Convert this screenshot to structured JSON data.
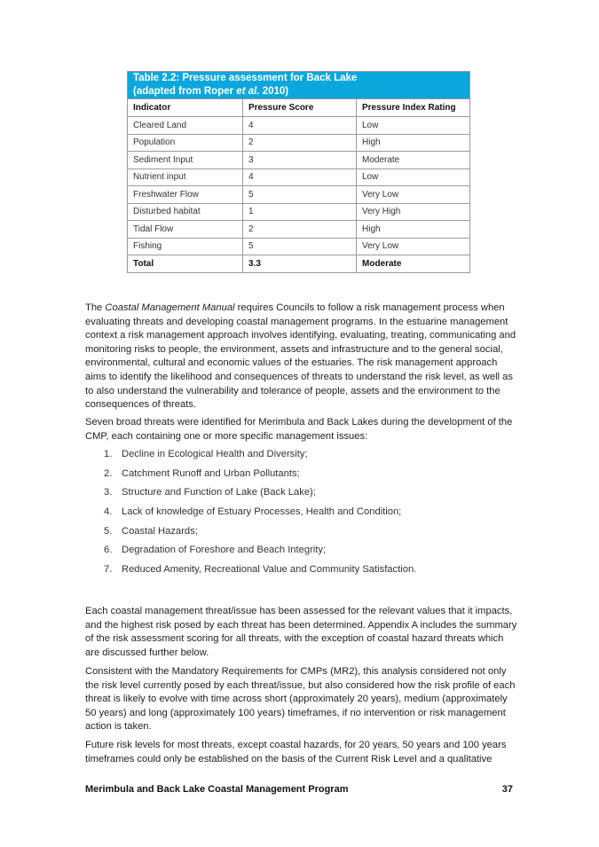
{
  "table": {
    "caption_prefix": "Table 2.2: Pressure assessment for Back Lake",
    "caption_line2_before": "(adapted from Roper ",
    "caption_line2_italic": "et al.",
    "caption_line2_after": " 2010)",
    "header_color": "#0aa7dc",
    "columns": [
      "Indicator",
      "Pressure Score",
      "Pressure Index Rating"
    ],
    "rows": [
      [
        "Cleared Land",
        "4",
        "Low"
      ],
      [
        "Population",
        "2",
        "High"
      ],
      [
        "Sediment Input",
        "3",
        "Moderate"
      ],
      [
        "Nutrient input",
        "4",
        "Low"
      ],
      [
        "Freshwater Flow",
        "5",
        "Very Low"
      ],
      [
        "Disturbed habitat",
        "1",
        "Very High"
      ],
      [
        "Tidal Flow",
        "2",
        "High"
      ],
      [
        "Fishing",
        "5",
        "Very Low"
      ]
    ],
    "total": [
      "Total",
      "3.3",
      "Moderate"
    ]
  },
  "paragraphs": {
    "p1_before": "The ",
    "p1_italic": "Coastal Management Manual",
    "p1_after": " requires Councils to follow a risk management process when evaluating threats and developing coastal management programs. In the estuarine management context a risk management approach involves identifying, evaluating, treating, communicating and monitoring risks to people, the environment, assets and infrastructure and to the general social, environmental, cultural and economic values of the estuaries. The risk management approach aims to identify the likelihood and consequences of threats to understand the risk level, as well as to also understand the vulnerability and tolerance of people, assets and the environment to the consequences of threats.",
    "p2": "Seven broad threats were identified for Merimbula and Back Lakes during the development of the CMP, each containing one or more specific management issues:",
    "p3": "Each coastal management threat/issue has been assessed for the relevant values that it impacts, and the highest risk posed by each threat has been determined. Appendix A includes the summary of the risk assessment scoring for all threats, with the exception of coastal hazard threats which are discussed further below.",
    "p4": "Consistent with the Mandatory Requirements for CMPs (MR2), this analysis considered not only the risk level currently posed by each threat/issue, but also considered how the risk profile of each threat is likely to evolve with time across short (approximately 20 years), medium (approximately 50 years) and long (approximately 100 years) timeframes, if no intervention or risk management action is taken.",
    "p5": "Future risk levels for most threats, except coastal hazards, for 20 years, 50 years and 100 years timeframes could only be established on the basis of the Current Risk Level and a qualitative"
  },
  "threats": [
    {
      "num": "1.",
      "text": "Decline in Ecological Health and Diversity;"
    },
    {
      "num": "2.",
      "text": "Catchment Runoff and Urban Pollutants;"
    },
    {
      "num": "3.",
      "text": "Structure and Function of Lake (Back Lake);"
    },
    {
      "num": "4.",
      "text": "Lack of knowledge of Estuary Processes, Health and Condition;"
    },
    {
      "num": "5.",
      "text": "Coastal Hazards;"
    },
    {
      "num": "6.",
      "text": "Degradation of Foreshore and Beach Integrity;"
    },
    {
      "num": "7.",
      "text": "Reduced Amenity, Recreational Value and Community Satisfaction."
    }
  ],
  "footer": {
    "title": "Merimbula and Back Lake Coastal Management Program",
    "page_number": "37"
  }
}
